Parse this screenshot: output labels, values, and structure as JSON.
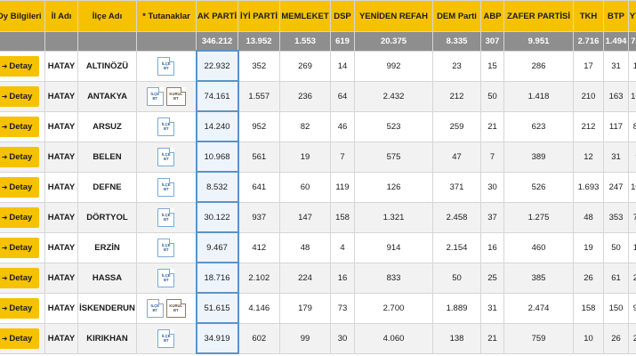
{
  "headers": [
    "Oy Bilgileri",
    "İl Adı",
    "İlçe Adı",
    "* Tutanaklar",
    "AK PARTİ",
    "İYİ PARTİ",
    "MEMLEKET",
    "DSP",
    "YENİDEN REFAH",
    "DEM Parti",
    "ABP",
    "ZAFER PARTİSİ",
    "TKH",
    "BTP",
    "YTP"
  ],
  "totals": [
    "346.212",
    "13.952",
    "1.553",
    "619",
    "20.375",
    "8.335",
    "307",
    "9.951",
    "2.716",
    "1.494",
    "757"
  ],
  "detay_label": "Detay",
  "doc_labels": {
    "ilce_1": "İLÇE",
    "ilce_2": "BT",
    "kurul_1": "KURUL",
    "kurul_2": "BT"
  },
  "rows": [
    {
      "il": "HATAY",
      "ilce": "ALTINÖZÜ",
      "kurul": false,
      "values": [
        "22.932",
        "352",
        "269",
        "14",
        "992",
        "23",
        "15",
        "286",
        "17",
        "31",
        "14"
      ]
    },
    {
      "il": "HATAY",
      "ilce": "ANTAKYA",
      "kurul": true,
      "values": [
        "74.161",
        "1.557",
        "236",
        "64",
        "2.432",
        "212",
        "50",
        "1.418",
        "210",
        "163",
        "164"
      ]
    },
    {
      "il": "HATAY",
      "ilce": "ARSUZ",
      "kurul": false,
      "values": [
        "14.240",
        "952",
        "82",
        "46",
        "523",
        "259",
        "21",
        "623",
        "212",
        "117",
        "80"
      ]
    },
    {
      "il": "HATAY",
      "ilce": "BELEN",
      "kurul": false,
      "values": [
        "10.968",
        "561",
        "19",
        "7",
        "575",
        "47",
        "7",
        "389",
        "12",
        "31",
        "9"
      ]
    },
    {
      "il": "HATAY",
      "ilce": "DEFNE",
      "kurul": false,
      "values": [
        "8.532",
        "641",
        "60",
        "119",
        "126",
        "371",
        "30",
        "526",
        "1.693",
        "247",
        "101"
      ]
    },
    {
      "il": "HATAY",
      "ilce": "DÖRTYOL",
      "kurul": false,
      "values": [
        "30.122",
        "937",
        "147",
        "158",
        "1.321",
        "2.458",
        "37",
        "1.275",
        "48",
        "353",
        "74"
      ]
    },
    {
      "il": "HATAY",
      "ilce": "ERZİN",
      "kurul": false,
      "values": [
        "9.467",
        "412",
        "48",
        "4",
        "914",
        "2.154",
        "16",
        "460",
        "19",
        "50",
        "17"
      ]
    },
    {
      "il": "HATAY",
      "ilce": "HASSA",
      "kurul": false,
      "values": [
        "18.716",
        "2.102",
        "224",
        "16",
        "833",
        "50",
        "25",
        "385",
        "26",
        "61",
        "26"
      ]
    },
    {
      "il": "HATAY",
      "ilce": "İSKENDERUN",
      "kurul": true,
      "values": [
        "51.615",
        "4.146",
        "179",
        "73",
        "2.700",
        "1.889",
        "31",
        "2.474",
        "158",
        "150",
        "90"
      ]
    },
    {
      "il": "HATAY",
      "ilce": "KIRIKHAN",
      "kurul": false,
      "values": [
        "34.919",
        "602",
        "99",
        "30",
        "4.060",
        "138",
        "21",
        "759",
        "10",
        "26",
        "23"
      ]
    }
  ]
}
